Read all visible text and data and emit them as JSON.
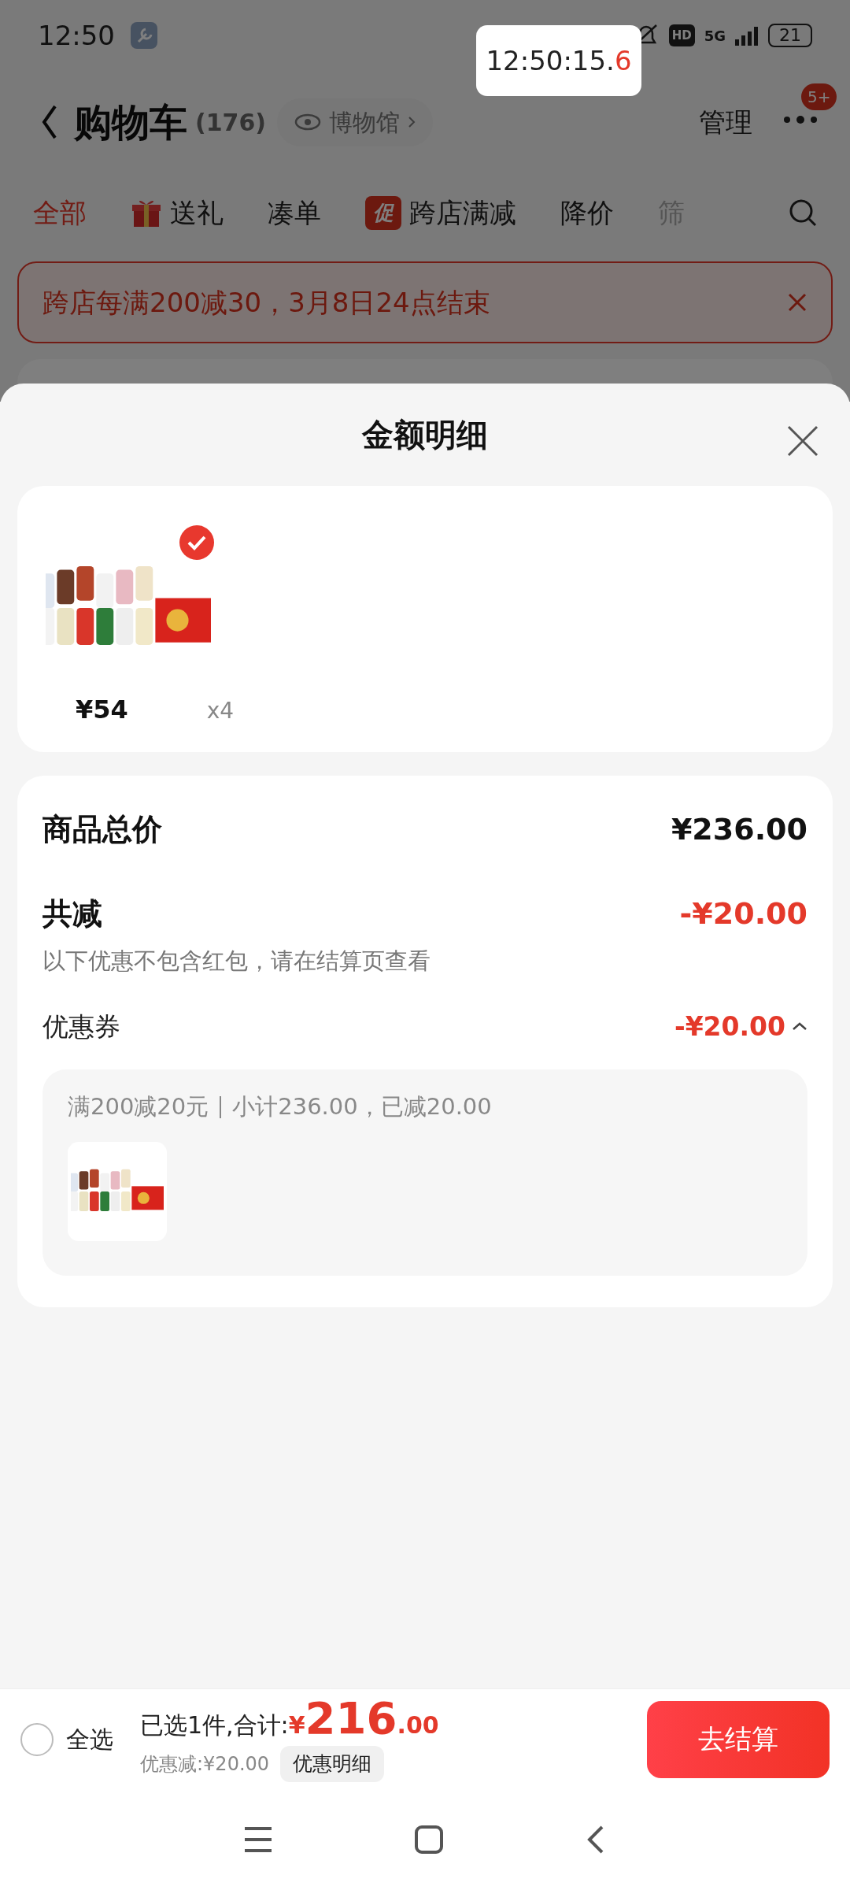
{
  "status_bar": {
    "time": "12:50",
    "hd": "HD",
    "network": "5G",
    "battery": "21"
  },
  "floating_clock": {
    "main": "12:50:15.",
    "last": "6"
  },
  "header": {
    "title": "购物车",
    "count": "(176)",
    "museum": "博物馆",
    "manage": "管理",
    "badge": "5+"
  },
  "tabs": [
    {
      "label": "全部",
      "selected": true,
      "kind": "plain"
    },
    {
      "label": "送礼",
      "selected": false,
      "kind": "gift"
    },
    {
      "label": "凑单",
      "selected": false,
      "kind": "plain"
    },
    {
      "label": "跨店满减",
      "selected": false,
      "kind": "promo",
      "tag": "促"
    },
    {
      "label": "降价",
      "selected": false,
      "kind": "plain"
    },
    {
      "label": "筛",
      "selected": false,
      "kind": "faded"
    }
  ],
  "banner": {
    "text": "跨店每满200减30，3月8日24点结束"
  },
  "sheet": {
    "title": "金额明细",
    "items": [
      {
        "kind": "picture",
        "checked": true,
        "price": "¥54",
        "quantity": "x4"
      }
    ],
    "summary": {
      "total_label": "商品总价",
      "total": "¥236.00",
      "discount_label": "共减",
      "discount": "-¥20.00",
      "note": "以下优惠不包含红包，请在结算页查看",
      "coupon_label": "优惠券",
      "coupon": "-¥20.00",
      "expanded": true,
      "rule": "满200减20元",
      "subtotal": "小计236.00，已减20.00"
    }
  },
  "bottom_bar": {
    "select_all": "全选",
    "all_checked": false,
    "selected_text": "已选1件,合计:",
    "currency": "¥",
    "amount": "216",
    "decimals": ".00",
    "saved": "优惠减:¥20.00",
    "details": "优惠明细",
    "checkout": "去结算"
  }
}
